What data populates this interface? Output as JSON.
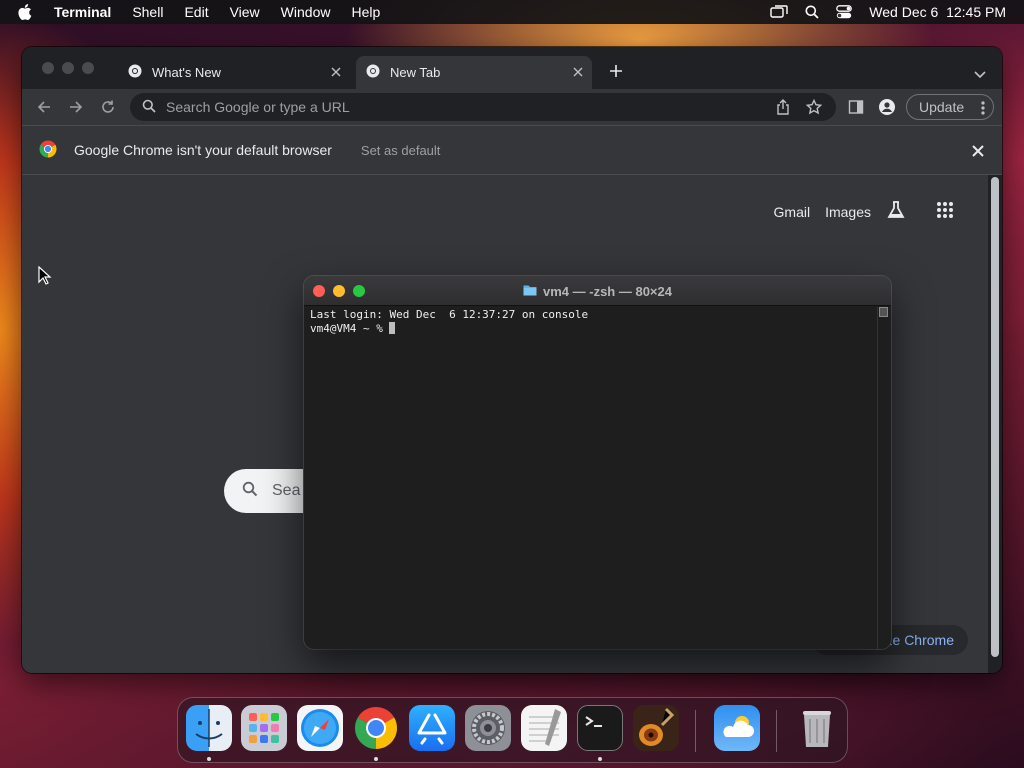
{
  "menubar": {
    "app_name": "Terminal",
    "items": [
      "Shell",
      "Edit",
      "View",
      "Window",
      "Help"
    ],
    "clock": "Wed Dec 6  12:45 PM",
    "icons": [
      "apple-logo",
      "screen-mirroring-icon",
      "spotlight-search-icon",
      "control-center-icon"
    ]
  },
  "chrome": {
    "tabs": [
      {
        "title": "What's New",
        "active": false
      },
      {
        "title": "New Tab",
        "active": true
      }
    ],
    "omnibox_placeholder": "Search Google or type a URL",
    "update_label": "Update",
    "infobar": {
      "message": "Google Chrome isn't your default browser",
      "action": "Set as default"
    },
    "ntp": {
      "links": [
        "Gmail",
        "Images"
      ],
      "search_placeholder": "Sea",
      "customize_label": "ize Chrome"
    }
  },
  "terminal": {
    "title": "vm4 — -zsh — 80×24",
    "lines": [
      "Last login: Wed Dec  6 12:37:27 on console",
      "vm4@VM4 ~ % "
    ]
  },
  "dock": {
    "apps": [
      {
        "name": "Finder",
        "running": true
      },
      {
        "name": "Launchpad",
        "running": false
      },
      {
        "name": "Safari",
        "running": false
      },
      {
        "name": "Google Chrome",
        "running": true
      },
      {
        "name": "App Store",
        "running": false
      },
      {
        "name": "System Settings",
        "running": false
      },
      {
        "name": "TextEdit",
        "running": false
      },
      {
        "name": "Terminal",
        "running": true
      },
      {
        "name": "GarageBand",
        "running": false
      },
      {
        "name": "Weather",
        "running": false
      },
      {
        "name": "Trash",
        "running": false
      }
    ]
  }
}
